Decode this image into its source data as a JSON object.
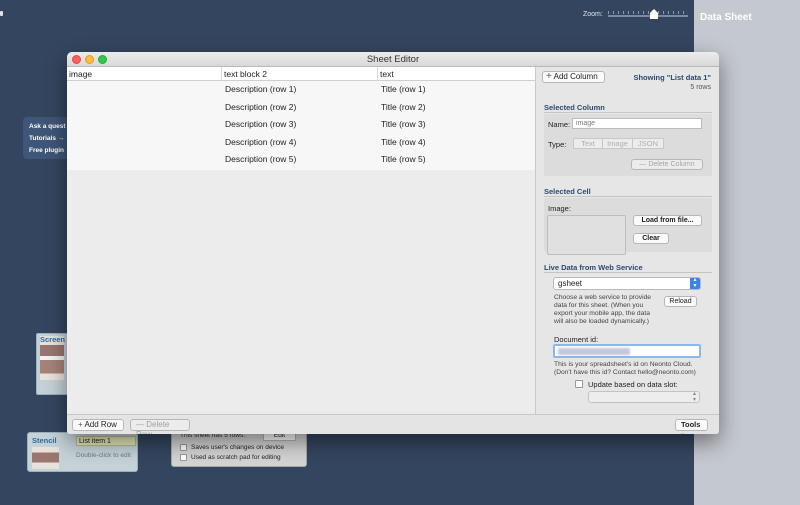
{
  "background": {
    "zoom_label": "Zoom:",
    "right_panel_title": "Data Sheet",
    "help_lines": [
      "Ask a quest",
      "Tutorials →",
      "Free plugin"
    ],
    "screen_card_label": "Screen",
    "stencil": {
      "label": "Stencil",
      "item": "List item 1",
      "hint": "Double-click to edit"
    },
    "sheet_panel": {
      "rows_text": "This sheet has 5 rows.",
      "edit_button": "Edit",
      "checkbox1": "Saves user's changes on device",
      "checkbox2": "Used as scratch pad for editing"
    }
  },
  "window": {
    "title": "Sheet Editor"
  },
  "table": {
    "columns": [
      "image",
      "text block 2",
      "text"
    ],
    "rows": [
      {
        "image": "",
        "description": "Description (row 1)",
        "title": "Title (row 1)"
      },
      {
        "image": "",
        "description": "Description (row 2)",
        "title": "Title (row 2)"
      },
      {
        "image": "",
        "description": "Description (row 3)",
        "title": "Title (row 3)"
      },
      {
        "image": "",
        "description": "Description (row 4)",
        "title": "Title (row 4)"
      },
      {
        "image": "",
        "description": "Description (row 5)",
        "title": "Title (row 5)"
      }
    ]
  },
  "bottom": {
    "add_row": "Add Row",
    "delete_row": "Delete Row",
    "tools": "Tools"
  },
  "inspector": {
    "add_column": "Add Column",
    "showing": "Showing \"List data 1\"",
    "rows_count": "5 rows",
    "selected_column": {
      "heading": "Selected Column",
      "name_label": "Name:",
      "name_placeholder": "image",
      "type_label": "Type:",
      "types": [
        "Text",
        "Image",
        "JSON"
      ],
      "delete_column": "Delete Column"
    },
    "selected_cell": {
      "heading": "Selected Cell",
      "image_label": "Image:",
      "load_button": "Load from file...",
      "clear_button": "Clear"
    },
    "live_data": {
      "heading": "Live Data from Web Service",
      "service": "gsheet",
      "description": "Choose a web service to provide data for this sheet. (When you export your mobile app, the data will also be loaded dynamically.)",
      "reload": "Reload",
      "doc_id_label": "Document id:",
      "doc_id_help": "This is your spreadsheet's id on Neonto Cloud. (Don't have this id? Contact hello@neonto.com)",
      "update_label": "Update based on data slot:"
    }
  }
}
